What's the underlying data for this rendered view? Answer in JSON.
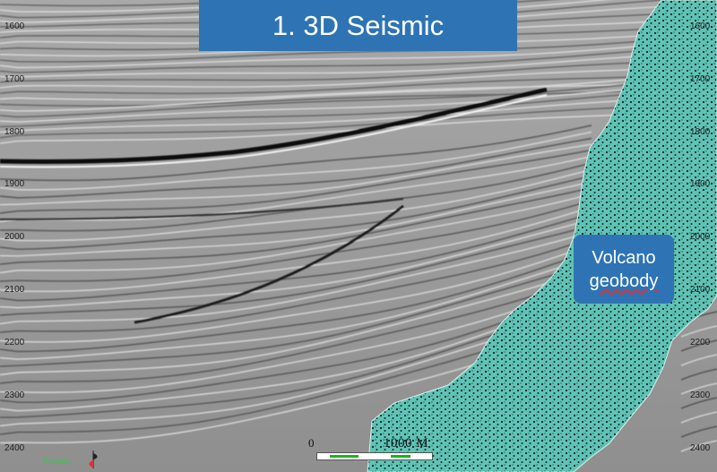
{
  "title": "1. 3D Seismic",
  "label": {
    "line1": "Volcano",
    "line2": "geobody"
  },
  "depth_ticks": [
    "1600",
    "1700",
    "1800",
    "1900",
    "2000",
    "2100",
    "2200",
    "2300",
    "2400"
  ],
  "polarity_label": "Polarity:",
  "scale": {
    "zero": "0",
    "distance": "1000 M"
  },
  "colors": {
    "title_bg": "#2e74b5",
    "geobody": "#5bbfb0",
    "scale_green": "#1db31d"
  }
}
